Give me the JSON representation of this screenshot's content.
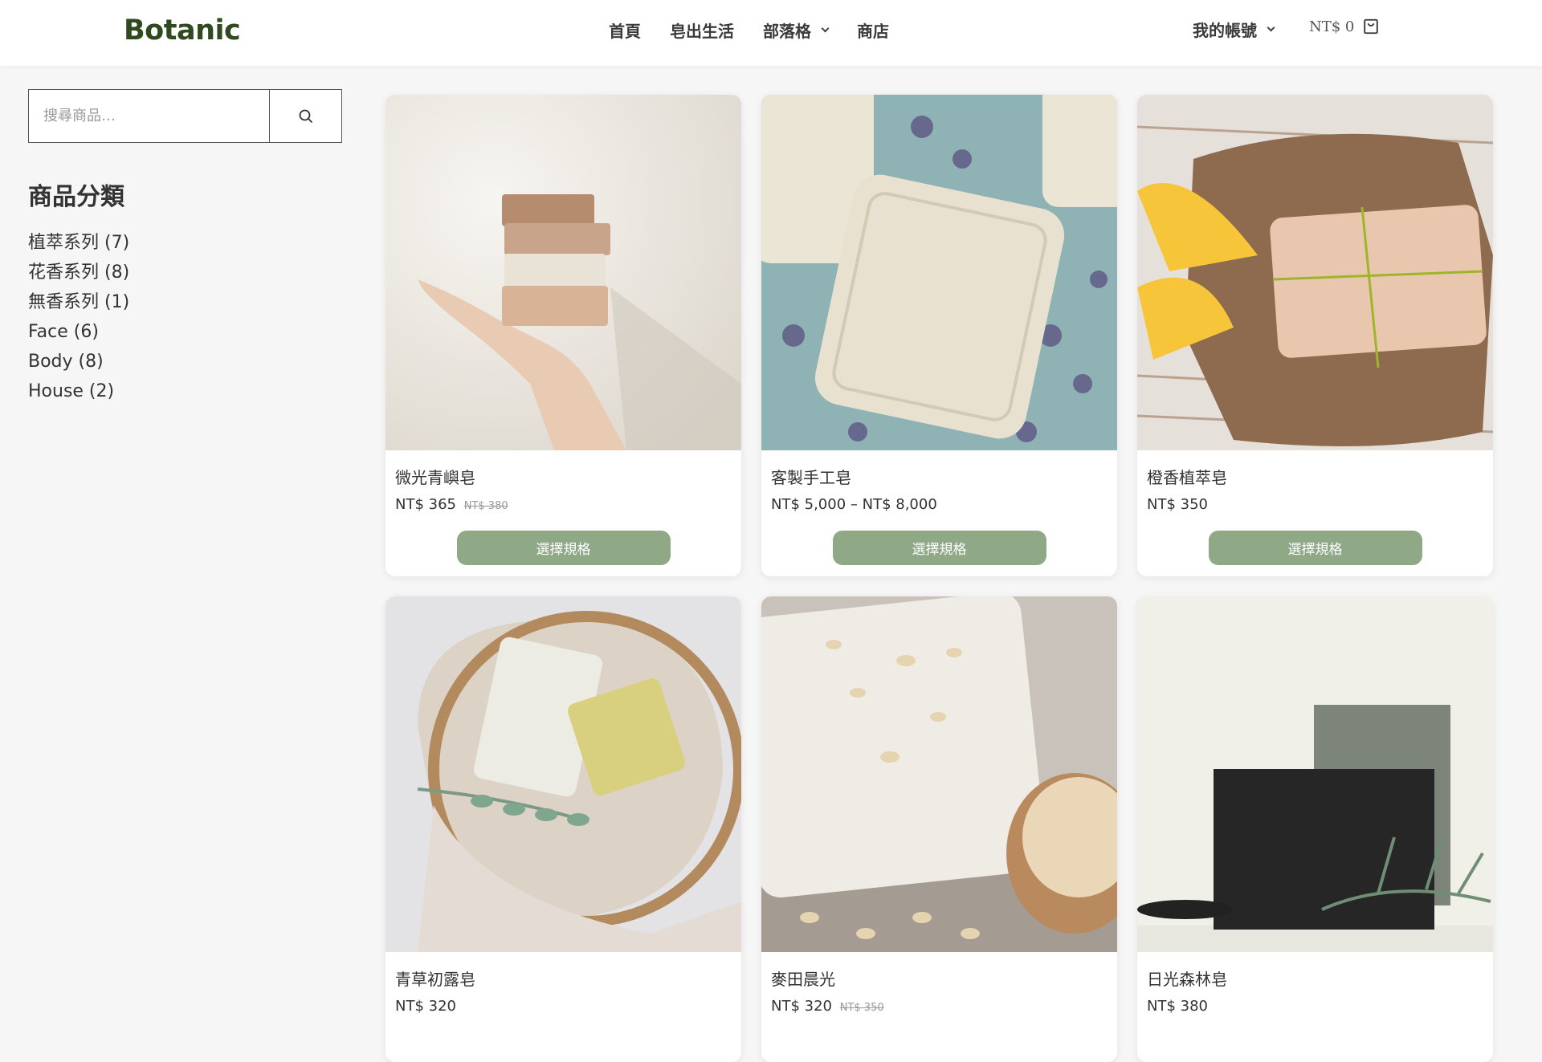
{
  "header": {
    "logo": "Botanic",
    "nav": [
      {
        "label": "首頁"
      },
      {
        "label": "皂出生活"
      },
      {
        "label": "部落格",
        "has_dropdown": true
      },
      {
        "label": "商店"
      }
    ],
    "account_label": "我的帳號",
    "cart_total": "NT$ 0"
  },
  "sidebar": {
    "search_placeholder": "搜尋商品…",
    "categories_title": "商品分類",
    "categories": [
      {
        "label": "植萃系列 (7)"
      },
      {
        "label": "花香系列 (8)"
      },
      {
        "label": "無香系列 (1)"
      },
      {
        "label": "Face (6)"
      },
      {
        "label": "Body (8)"
      },
      {
        "label": "House (2)"
      }
    ]
  },
  "products": [
    {
      "name": "微光青嶼皂",
      "price": "NT$ 365",
      "old_price": "NT$ 380",
      "button": "選擇規格"
    },
    {
      "name": "客製手工皂",
      "price": "NT$ 5,000 – NT$ 8,000",
      "old_price": "",
      "button": "選擇規格"
    },
    {
      "name": "橙香植萃皂",
      "price": "NT$ 350",
      "old_price": "",
      "button": "選擇規格"
    },
    {
      "name": "青草初露皂",
      "price": "NT$ 320",
      "old_price": ""
    },
    {
      "name": "麥田晨光",
      "price": "NT$ 320",
      "old_price": "NT$ 350"
    },
    {
      "name": "日光森林皂",
      "price": "NT$ 380",
      "old_price": ""
    }
  ],
  "colors": {
    "logo": "#2f4a1e",
    "button": "#8fa886"
  }
}
